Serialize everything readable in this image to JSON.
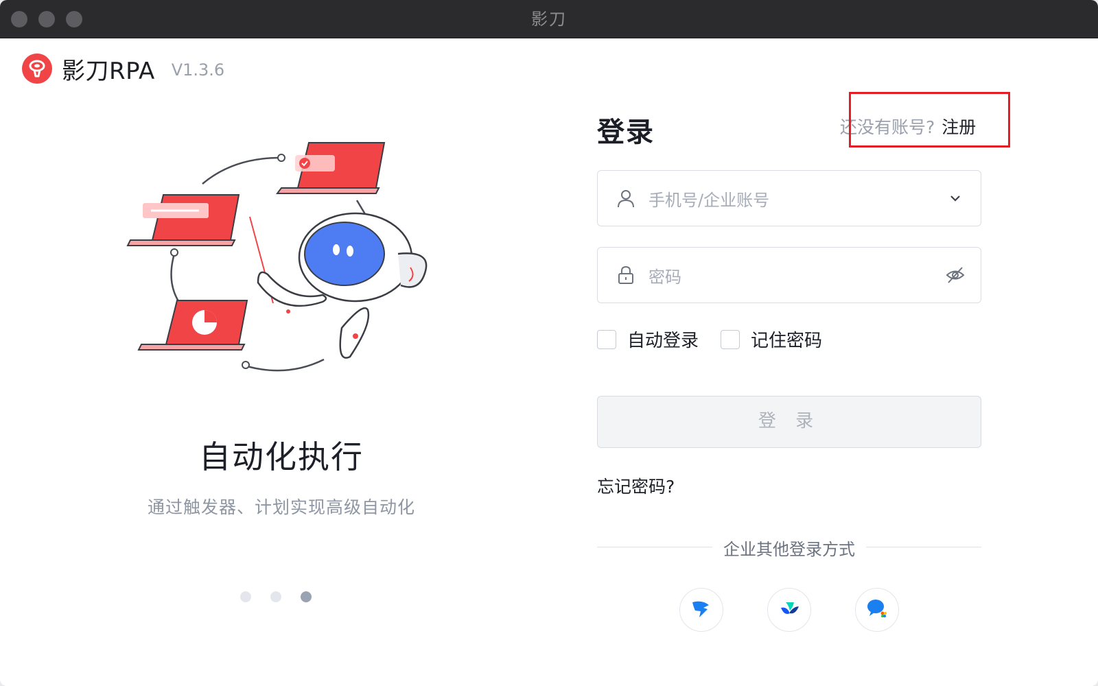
{
  "window": {
    "title": "影刀"
  },
  "brand": {
    "name": "影刀RPA",
    "version": "V1.3.6",
    "accent": "#f04447"
  },
  "carousel": {
    "title": "自动化执行",
    "subtitle": "通过触发器、计划实现高级自动化",
    "slides": 3,
    "active_slide": 3
  },
  "login": {
    "title": "登录",
    "no_account": "还没有账号?",
    "register": "注册",
    "username_placeholder": "手机号/企业账号",
    "password_placeholder": "密码",
    "auto_login": "自动登录",
    "remember_password": "记住密码",
    "submit": "登 录",
    "forgot": "忘记密码?",
    "other_methods": "企业其他登录方式"
  },
  "icons": {
    "user": "user-icon",
    "lock": "lock-icon",
    "dropdown": "chevron-down-icon",
    "eye": "eye-off-icon",
    "sso": [
      "dingtalk-icon",
      "feishu-icon",
      "wecom-icon"
    ]
  },
  "colors": {
    "highlight": "#e51c23",
    "text_muted": "#9aa1ad"
  }
}
